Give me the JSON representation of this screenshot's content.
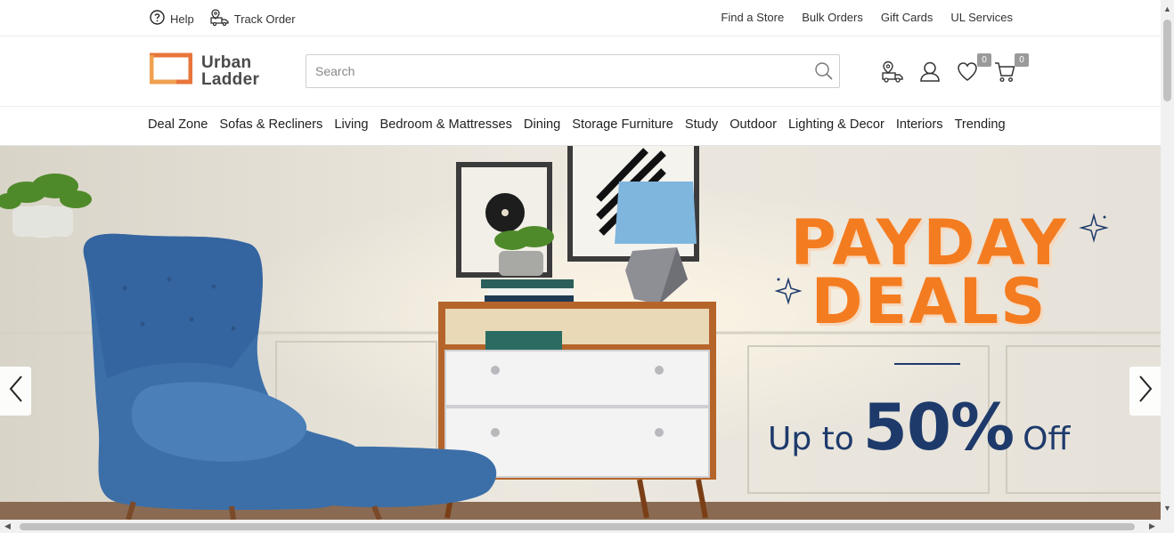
{
  "topbar": {
    "help_label": "Help",
    "track_order_label": "Track Order",
    "links": [
      "Find a Store",
      "Bulk Orders",
      "Gift Cards",
      "UL Services"
    ]
  },
  "header": {
    "logo_line1": "Urban",
    "logo_line2": "Ladder",
    "search_placeholder": "Search",
    "wishlist_count": "0",
    "cart_count": "0"
  },
  "nav": {
    "items": [
      "Deal Zone",
      "Sofas & Recliners",
      "Living",
      "Bedroom & Mattresses",
      "Dining",
      "Storage Furniture",
      "Study",
      "Outdoor",
      "Lighting & Decor",
      "Interiors",
      "Trending"
    ]
  },
  "hero": {
    "title_line1": "PAYDAY",
    "title_line2": "DEALS",
    "offer_prefix": "Up to",
    "offer_value": "50%",
    "offer_suffix": "Off"
  },
  "icons": {
    "help": "question-circle-icon",
    "track": "truck-icon",
    "search": "magnifier-icon",
    "store": "store-location-icon",
    "account": "user-icon",
    "wishlist": "heart-icon",
    "cart": "cart-icon",
    "prev": "chevron-left-icon",
    "next": "chevron-right-icon"
  },
  "colors": {
    "brand_orange": "#f47c20",
    "brand_navy": "#1e3a6b"
  }
}
